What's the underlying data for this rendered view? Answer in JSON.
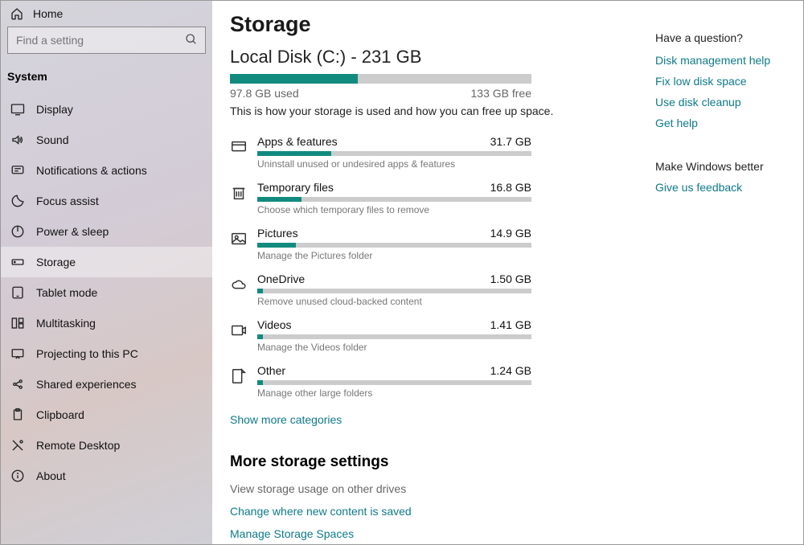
{
  "sidebar": {
    "home": "Home",
    "search_placeholder": "Find a setting",
    "section": "System",
    "items": [
      {
        "id": "display",
        "label": "Display"
      },
      {
        "id": "sound",
        "label": "Sound"
      },
      {
        "id": "notifications",
        "label": "Notifications & actions"
      },
      {
        "id": "focus",
        "label": "Focus assist"
      },
      {
        "id": "power",
        "label": "Power & sleep"
      },
      {
        "id": "storage",
        "label": "Storage",
        "active": true
      },
      {
        "id": "tablet",
        "label": "Tablet mode"
      },
      {
        "id": "multitasking",
        "label": "Multitasking"
      },
      {
        "id": "projecting",
        "label": "Projecting to this PC"
      },
      {
        "id": "shared",
        "label": "Shared experiences"
      },
      {
        "id": "clipboard",
        "label": "Clipboard"
      },
      {
        "id": "remote",
        "label": "Remote Desktop"
      },
      {
        "id": "about",
        "label": "About"
      }
    ]
  },
  "page": {
    "title": "Storage",
    "disk_title": "Local Disk (C:) - 231 GB",
    "used_label": "97.8 GB used",
    "free_label": "133 GB free",
    "intro": "This is how your storage is used and how you can free up space.",
    "show_more": "Show more categories",
    "more_heading": "More storage settings",
    "more_links": [
      {
        "label": "View storage usage on other drives",
        "muted": true
      },
      {
        "label": "Change where new content is saved"
      },
      {
        "label": "Manage Storage Spaces"
      }
    ]
  },
  "categories": [
    {
      "id": "apps",
      "name": "Apps & features",
      "size": "31.7 GB",
      "hint": "Uninstall unused or undesired apps & features",
      "pct": 27
    },
    {
      "id": "temp",
      "name": "Temporary files",
      "size": "16.8 GB",
      "hint": "Choose which temporary files to remove",
      "pct": 16
    },
    {
      "id": "pictures",
      "name": "Pictures",
      "size": "14.9 GB",
      "hint": "Manage the Pictures folder",
      "pct": 14
    },
    {
      "id": "onedrive",
      "name": "OneDrive",
      "size": "1.50 GB",
      "hint": "Remove unused cloud-backed content",
      "pct": 2
    },
    {
      "id": "videos",
      "name": "Videos",
      "size": "1.41 GB",
      "hint": "Manage the Videos folder",
      "pct": 2
    },
    {
      "id": "other",
      "name": "Other",
      "size": "1.24 GB",
      "hint": "Manage other large folders",
      "pct": 2
    }
  ],
  "right": {
    "question": "Have a question?",
    "links": [
      "Disk management help",
      "Fix low disk space",
      "Use disk cleanup",
      "Get help"
    ],
    "improve": "Make Windows better",
    "feedback": "Give us feedback"
  },
  "chart_data": {
    "type": "bar",
    "title": "Local Disk (C:) - 231 GB",
    "total_gb": 231,
    "used_gb": 97.8,
    "free_gb": 133,
    "categories": [
      "Apps & features",
      "Temporary files",
      "Pictures",
      "OneDrive",
      "Videos",
      "Other"
    ],
    "values_gb": [
      31.7,
      16.8,
      14.9,
      1.5,
      1.41,
      1.24
    ],
    "ylabel": "GB",
    "xlabel": ""
  }
}
